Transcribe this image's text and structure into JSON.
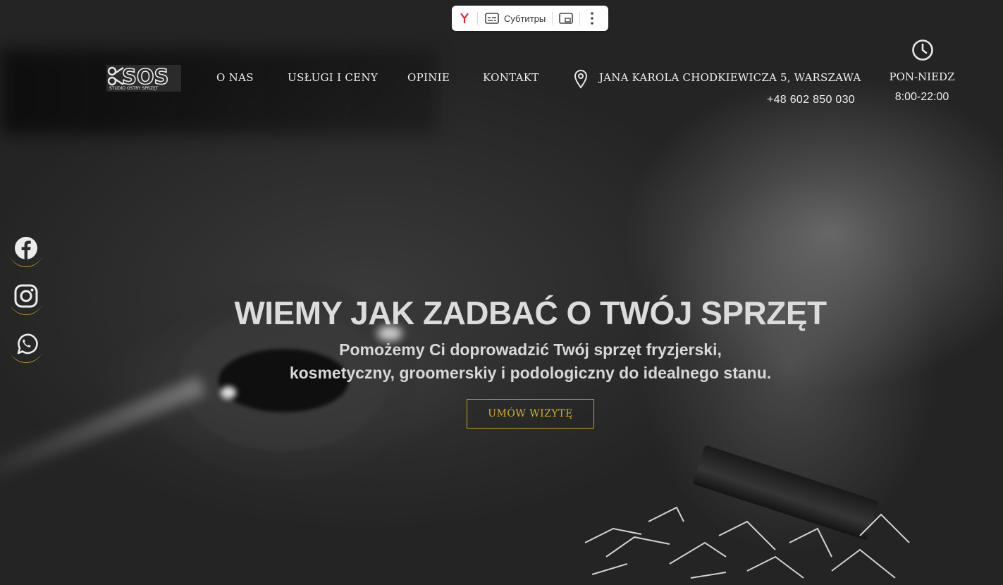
{
  "browser_toolbar": {
    "browser_icon": "yandex-icon",
    "subtitles_label": "Субтитры",
    "pip_icon": "picture-in-picture-icon",
    "more_icon": "vertical-dots-icon"
  },
  "header": {
    "logo_text": "SOS",
    "logo_tagline": "STUDIO OSTRY SPRZĘT",
    "nav": [
      {
        "label": "O NAS"
      },
      {
        "label": "USŁUGI I CENY"
      },
      {
        "label": "OPINIE"
      },
      {
        "label": "KONTAKT"
      }
    ],
    "address": "JANA KAROLA CHODKIEWICZA 5, WARSZAWA",
    "phone": "+48 602 850 030",
    "hours_label": "PON-NIEDZ",
    "hours_time": "8:00-22:00"
  },
  "social": [
    {
      "name": "facebook",
      "icon": "facebook-icon"
    },
    {
      "name": "instagram",
      "icon": "instagram-icon"
    },
    {
      "name": "whatsapp",
      "icon": "whatsapp-icon"
    }
  ],
  "hero": {
    "title": "WIEMY JAK ZADBAĆ O TWÓJ SPRZĘT",
    "subtitle_line1": "Pomożemy Ci doprowadzić Twój sprzęt fryzjerski,",
    "subtitle_line2": "kosmetyczny, groomerskiy i podologiczny do idealnego stanu.",
    "cta_label": "UMÓW WIZYTĘ"
  },
  "colors": {
    "accent_gold": "#c9a227",
    "text_light": "#efefef",
    "background_dark": "#2b2b2b"
  }
}
